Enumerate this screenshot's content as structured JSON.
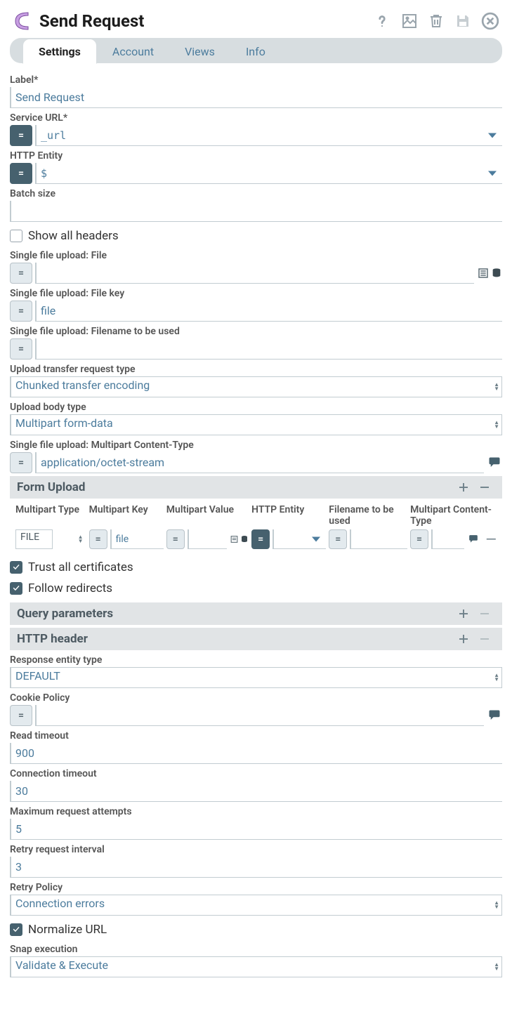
{
  "header": {
    "title": "Send Request"
  },
  "tabs": {
    "active": "Settings",
    "items": [
      "Settings",
      "Account",
      "Views",
      "Info"
    ]
  },
  "fields": {
    "label": {
      "lbl": "Label*",
      "value": "Send Request"
    },
    "service_url": {
      "lbl": "Service URL*",
      "value": "_url"
    },
    "http_entity": {
      "lbl": "HTTP Entity",
      "value": "$"
    },
    "batch_size": {
      "lbl": "Batch size",
      "value": ""
    },
    "show_all_headers": {
      "lbl": "Show all headers",
      "checked": false
    },
    "sfu_file": {
      "lbl": "Single file upload: File",
      "value": ""
    },
    "sfu_file_key": {
      "lbl": "Single file upload: File key",
      "value": "file"
    },
    "sfu_filename": {
      "lbl": "Single file upload: Filename to be used",
      "value": ""
    },
    "upload_transfer_type": {
      "lbl": "Upload transfer request type",
      "value": "Chunked transfer encoding"
    },
    "upload_body_type": {
      "lbl": "Upload body type",
      "value": "Multipart form-data"
    },
    "sfu_multipart_ct": {
      "lbl": "Single file upload: Multipart Content-Type",
      "value": "application/octet-stream"
    },
    "trust_all": {
      "lbl": "Trust all certificates",
      "checked": true
    },
    "follow_redirects": {
      "lbl": "Follow redirects",
      "checked": true
    },
    "response_entity_type": {
      "lbl": "Response entity type",
      "value": "DEFAULT"
    },
    "cookie_policy": {
      "lbl": "Cookie Policy",
      "value": ""
    },
    "read_timeout": {
      "lbl": "Read timeout",
      "value": "900"
    },
    "connection_timeout": {
      "lbl": "Connection timeout",
      "value": "30"
    },
    "max_attempts": {
      "lbl": "Maximum request attempts",
      "value": "5"
    },
    "retry_interval": {
      "lbl": "Retry request interval",
      "value": "3"
    },
    "retry_policy": {
      "lbl": "Retry Policy",
      "value": "Connection errors"
    },
    "normalize_url": {
      "lbl": "Normalize URL",
      "checked": true
    },
    "snap_execution": {
      "lbl": "Snap execution",
      "value": "Validate & Execute"
    }
  },
  "sections": {
    "form_upload": {
      "title": "Form Upload",
      "columns": [
        "Multipart Type",
        "Multipart Key",
        "Multipart Value",
        "HTTP Entity",
        "Filename to be used",
        "Multipart Content-Type"
      ],
      "row": {
        "type": "FILE",
        "key": "file",
        "value": "",
        "entity": "",
        "filename": "",
        "ctype": ""
      }
    },
    "query_params": {
      "title": "Query parameters"
    },
    "http_header": {
      "title": "HTTP header"
    }
  }
}
